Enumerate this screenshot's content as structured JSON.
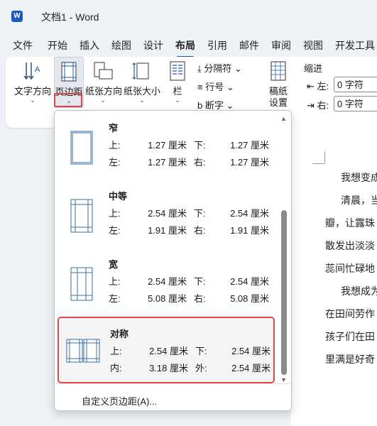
{
  "app": {
    "logo": "W",
    "title": "文档1  -  Word"
  },
  "tabs": [
    "文件",
    "开始",
    "插入",
    "绘图",
    "设计",
    "布局",
    "引用",
    "邮件",
    "审阅",
    "视图",
    "开发工具"
  ],
  "ribbon": {
    "text_direction": "文字方向",
    "margins": "页边距",
    "orientation": "纸张方向",
    "size": "纸张大小",
    "columns": "栏",
    "breaks": "分隔符",
    "line_numbers": "行号",
    "hyphenation": "断字",
    "manuscript": [
      "稿纸",
      "设置"
    ],
    "indent": {
      "title": "缩进",
      "left_label": "左:",
      "left_value": "0 字符",
      "right_label": "右:",
      "right_value": "0 字符"
    }
  },
  "margin_options": [
    {
      "name": "窄",
      "r1k": "上:",
      "r1v": "1.27 厘米",
      "r1k2": "下:",
      "r1v2": "1.27 厘米",
      "r2k": "左:",
      "r2v": "1.27 厘米",
      "r2k2": "右:",
      "r2v2": "1.27 厘米"
    },
    {
      "name": "中等",
      "r1k": "上:",
      "r1v": "2.54 厘米",
      "r1k2": "下:",
      "r1v2": "2.54 厘米",
      "r2k": "左:",
      "r2v": "1.91 厘米",
      "r2k2": "右:",
      "r2v2": "1.91 厘米"
    },
    {
      "name": "宽",
      "r1k": "上:",
      "r1v": "2.54 厘米",
      "r1k2": "下:",
      "r1v2": "2.54 厘米",
      "r2k": "左:",
      "r2v": "5.08 厘米",
      "r2k2": "右:",
      "r2v2": "5.08 厘米"
    },
    {
      "name": "对称",
      "r1k": "上:",
      "r1v": "2.54 厘米",
      "r1k2": "下:",
      "r1v2": "2.54 厘米",
      "r2k": "内:",
      "r2v": "3.18 厘米",
      "r2k2": "外:",
      "r2v2": "2.54 厘米"
    }
  ],
  "custom_margins": "自定义页边距(A)...",
  "document": {
    "lines": [
      "我想变成",
      "清晨，当",
      "瓣，让露珠",
      "散发出淡淡",
      "蕊间忙碌地",
      "我想成为",
      "在田间劳作",
      "孩子们在田",
      "里满是好奇"
    ]
  },
  "colors": {
    "accent": "#185abd",
    "highlight": "#e0474a"
  }
}
